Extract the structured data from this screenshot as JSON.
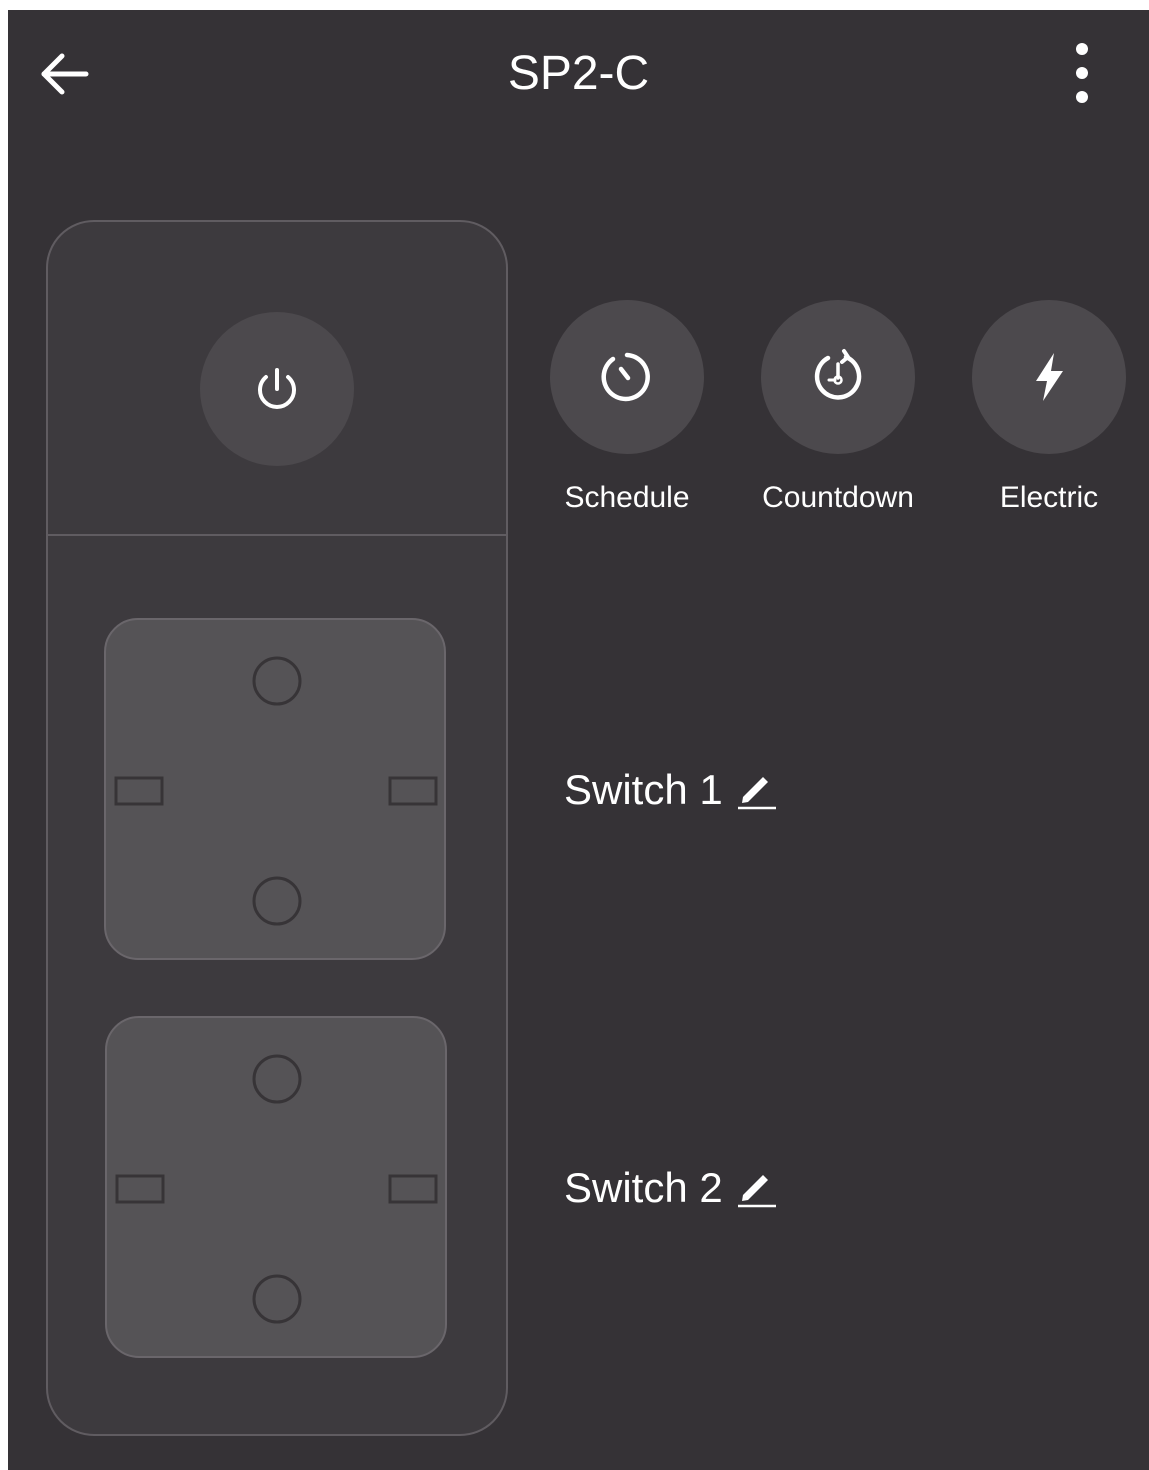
{
  "header": {
    "title": "SP2-C",
    "back_icon": "arrow-left-icon",
    "more_icon": "more-vert-icon"
  },
  "colors": {
    "background": "#353236",
    "panel": "#3d3a3e",
    "button": "#4c494d",
    "socket": "#555356",
    "text": "#ffffff"
  },
  "power_strip": {
    "master_power_icon": "power-icon",
    "sockets": [
      {
        "name": "socket-1",
        "state": "off"
      },
      {
        "name": "socket-2",
        "state": "off"
      }
    ]
  },
  "features": [
    {
      "label": "Schedule",
      "icon": "schedule-icon"
    },
    {
      "label": "Countdown",
      "icon": "countdown-icon"
    },
    {
      "label": "Electric",
      "icon": "lightning-icon"
    }
  ],
  "switches": [
    {
      "label": "Switch 1",
      "edit_icon": "pencil-icon"
    },
    {
      "label": "Switch 2",
      "edit_icon": "pencil-icon"
    }
  ]
}
